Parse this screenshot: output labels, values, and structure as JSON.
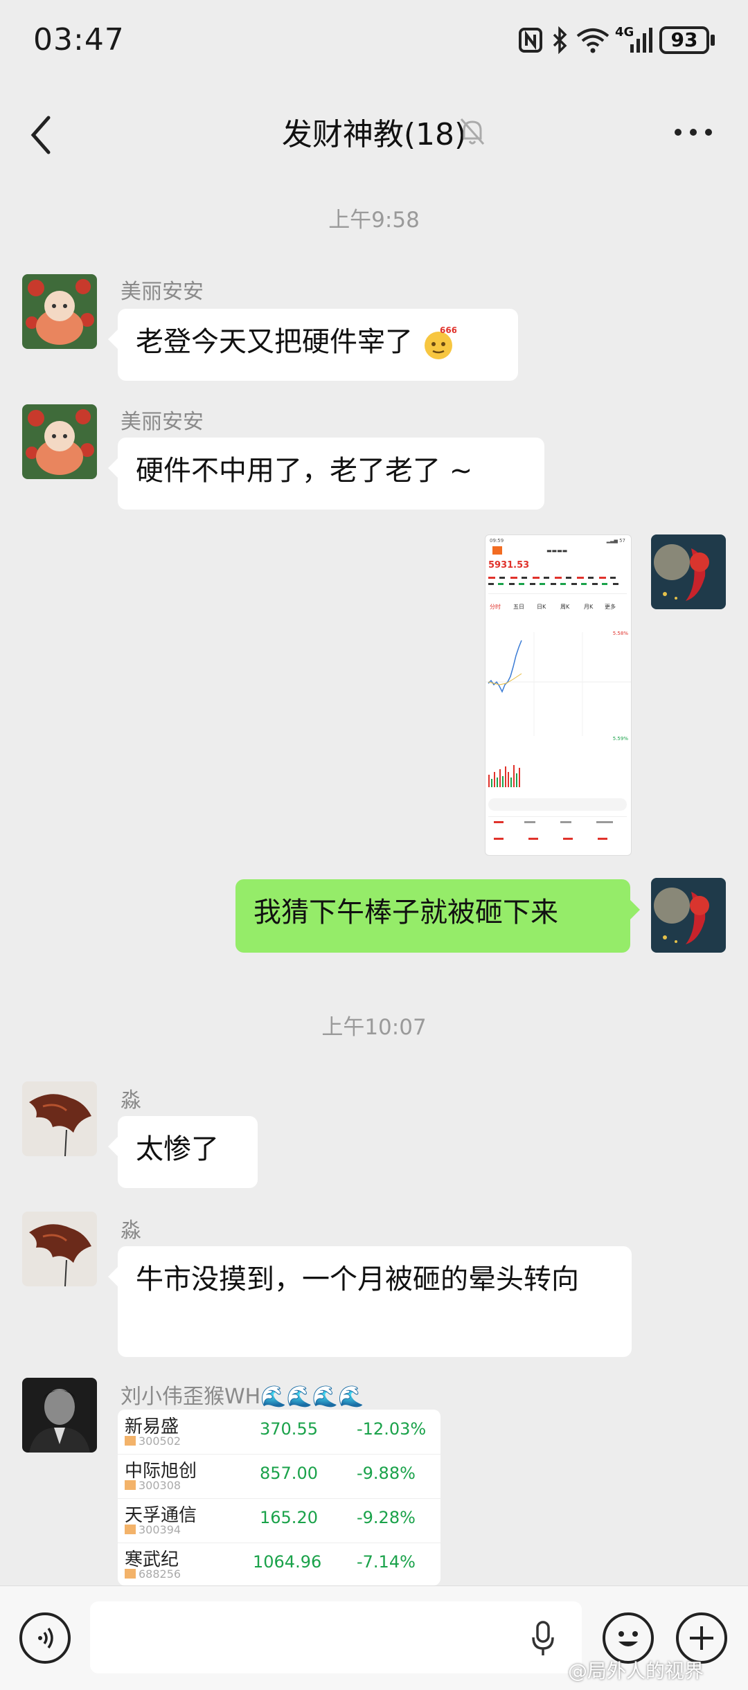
{
  "status_bar": {
    "time": "03:47",
    "signal": "4G",
    "battery": "93"
  },
  "header": {
    "title": "发财神教(18)"
  },
  "messages": {
    "time1": "上午9:58",
    "m1_sender": "美丽安安",
    "m1_text": "老登今天又把硬件宰了",
    "m2_sender": "美丽安安",
    "m2_text": "硬件不中用了，老了老了 ~",
    "m4_text": "我猜下午棒子就被砸下来",
    "time2": "上午10:07",
    "m5_sender": "淼",
    "m5_text": "太惨了",
    "m6_sender": "淼",
    "m6_text": "牛市没摸到，一个月被砸的晕头转向",
    "m7_sender": "刘小伟歪猴WH🌊🌊🌊🌊"
  },
  "stock_card": {
    "rows": [
      {
        "name": "新易盛",
        "code": "300502",
        "price": "370.55",
        "pct": "-12.03%"
      },
      {
        "name": "中际旭创",
        "code": "300308",
        "price": "857.00",
        "pct": "-9.88%"
      },
      {
        "name": "天孚通信",
        "code": "300394",
        "price": "165.20",
        "pct": "-9.28%"
      },
      {
        "name": "寒武纪",
        "code": "688256",
        "price": "1064.96",
        "pct": "-7.14%"
      }
    ]
  },
  "screenshot": {
    "index_value": "5931.53",
    "labels": [
      "分时",
      "五日",
      "日K",
      "周K",
      "月K",
      "更多"
    ],
    "high": "5.58%",
    "low": "5.59%"
  },
  "watermark": "@局外人的视界",
  "colors": {
    "background": "#ededed",
    "bubble_green": "#95ec69",
    "stock_green": "#1aa24a"
  },
  "icons": [
    "back-chevron",
    "mute-bell",
    "more-dots",
    "voice",
    "mic",
    "emoji",
    "plus",
    "nfc",
    "bluetooth",
    "wifi"
  ]
}
